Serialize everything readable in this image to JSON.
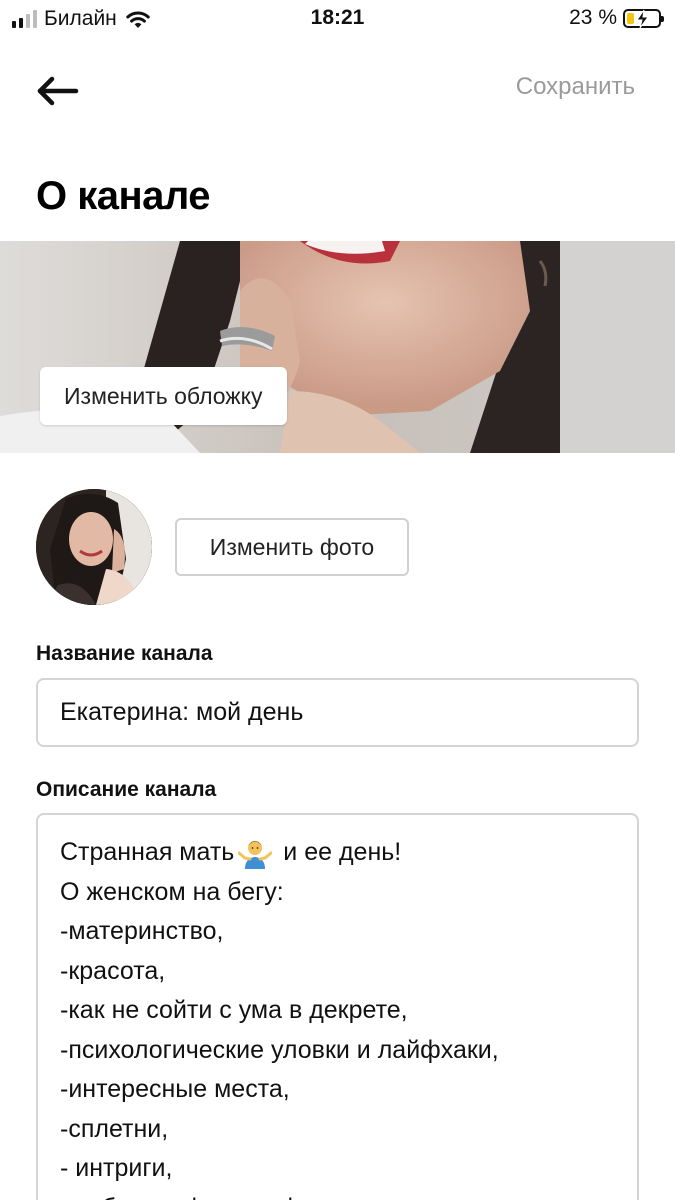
{
  "status_bar": {
    "carrier": "Билайн",
    "time": "18:21",
    "battery_percent": "23 %",
    "battery_level": 0.23,
    "charging": true
  },
  "header": {
    "back_icon": "arrow-left-icon",
    "save_label": "Сохранить",
    "title": "О канале"
  },
  "cover": {
    "change_cover_label": "Изменить обложку"
  },
  "avatar": {
    "change_photo_label": "Изменить фото"
  },
  "form": {
    "name_label": "Название канала",
    "name_value": "Екатерина: мой день",
    "description_label": "Описание канала",
    "description_lines": [
      {
        "text": "Странная мать",
        "after_emoji": " и ее день!",
        "emoji": "person-shrugging-emoji"
      },
      {
        "text": "О женском на бегу:"
      },
      {
        "text": "-материнство,"
      },
      {
        "text": "-красота,"
      },
      {
        "text": "-как не сойти с ума в декрете,"
      },
      {
        "text": "-психологические уловки и лайфхаки,"
      },
      {
        "text": "-интересные места,"
      },
      {
        "text": "-сплетни,"
      },
      {
        "text": "- интриги,"
      },
      {
        "text": "-любовь и фотографии"
      }
    ]
  },
  "colors": {
    "save_text": "#9a9a9a",
    "input_border": "#d4d4d4",
    "battery_fill": "#f2c511"
  }
}
